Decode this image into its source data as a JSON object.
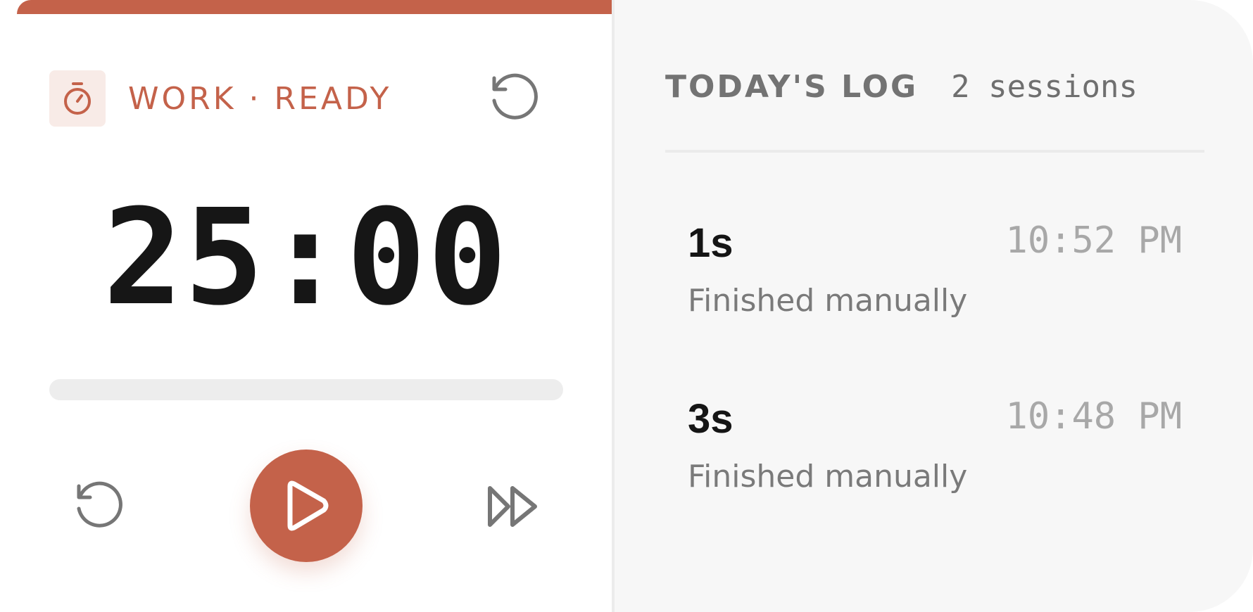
{
  "timer": {
    "mode_label": "WORK · READY",
    "display": "25:00",
    "progress_fraction": 0,
    "accent_color": "#c4624a"
  },
  "controls": {
    "reset_icon": "reset-icon",
    "play_icon": "play-icon",
    "skip_icon": "skip-forward-icon",
    "mode_icon": "stopwatch-icon"
  },
  "log": {
    "title": "TODAY'S LOG",
    "count": "2 sessions",
    "items": [
      {
        "duration": "1s",
        "time": "10:52 PM",
        "note": "Finished manually"
      },
      {
        "duration": "3s",
        "time": "10:48 PM",
        "note": "Finished manually"
      }
    ]
  }
}
